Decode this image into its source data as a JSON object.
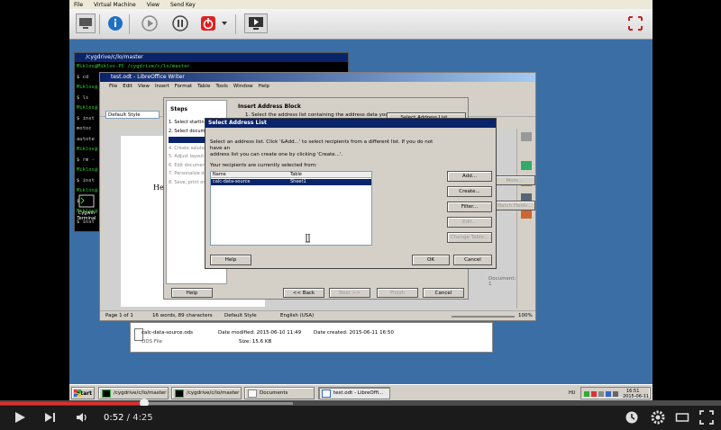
{
  "vm_menu": [
    "File",
    "Virtual Machine",
    "View",
    "Send Key"
  ],
  "cygwin": {
    "title": "/cygdrive/c/lo/master",
    "lines": [
      {
        "text": "Miklos@Miklos-PC /cygdrive/c/lo/master",
        "green": true
      },
      {
        "text": "$ cd",
        "green": false
      },
      {
        "text": "Miklos@",
        "green": true
      },
      {
        "text": "$ ls",
        "green": false
      },
      {
        "text": "Miklos@",
        "green": true
      },
      {
        "text": "$ inst",
        "green": false
      },
      {
        "text": "motoc",
        "green": false
      },
      {
        "text": "autote",
        "green": false
      },
      {
        "text": "Miklos@",
        "green": true
      },
      {
        "text": "$ rm -",
        "green": false
      },
      {
        "text": "Miklos@",
        "green": true
      },
      {
        "text": "$ inst",
        "green": false
      },
      {
        "text": "Miklos@",
        "green": true
      },
      {
        "text": "$ rm -",
        "green": false
      },
      {
        "text": "Miklos@",
        "green": true
      },
      {
        "text": "$ inst",
        "green": false
      }
    ]
  },
  "desktop_icon": {
    "line1": "Cygwin",
    "line2": "Terminal"
  },
  "writer": {
    "title": "test.odt - LibreOffice Writer",
    "menu": [
      "File",
      "Edit",
      "View",
      "Insert",
      "Format",
      "Table",
      "Tools",
      "Window",
      "Help"
    ],
    "style": "Default Style",
    "page_text": "Hel",
    "status": {
      "page": "Page 1 of 1",
      "words": "16 words, 89 characters",
      "style": "Default Style",
      "lang": "English (USA)",
      "zoom": "100%"
    }
  },
  "wizard": {
    "steps_title": "Steps",
    "steps": [
      {
        "label": "1. Select starting",
        "state": "normal"
      },
      {
        "label": "2. Select document",
        "state": "normal"
      },
      {
        "label": "3. Insert address",
        "state": "selected"
      },
      {
        "label": "4. Create salutati",
        "state": "dim"
      },
      {
        "label": "5. Adjust layout",
        "state": "dim"
      },
      {
        "label": "6. Edit document",
        "state": "dim"
      },
      {
        "label": "7. Personalize do",
        "state": "dim"
      },
      {
        "label": "8. Save, print or",
        "state": "dim"
      }
    ],
    "heading": "Insert Address Block",
    "step1": "1.      Select the address list containing the address data you",
    "select_list_btn": "Select Address List...",
    "more_btn": "More...",
    "match_btn": "Match Fields...",
    "document_label": "Document: 1",
    "help": "Help",
    "back": "<< Back",
    "next": "Next >>",
    "finish": "Finish",
    "cancel": "Cancel"
  },
  "select_address_list": {
    "title": "Select Address List",
    "desc1": "Select an address list. Click '&Add...' to select recipients from a different list. If you do not have an",
    "desc2": "address list you can create one by clicking 'Create...'.",
    "current": "Your recipients are currently selected from:",
    "col_name": "Name",
    "col_table": "Table",
    "row_name": "calc-data-source",
    "row_table": "Sheet1",
    "add": "Add...",
    "create": "Create...",
    "filter": "Filter...",
    "edit": "Edit...",
    "change_table": "Change Table...",
    "help": "Help",
    "ok": "OK",
    "cancel": "Cancel"
  },
  "explorer": {
    "file": "calc-data-source.ods",
    "type": "ODS File",
    "modified": "Date modified: 2015-06-10 11:49",
    "size": "Size: 15.6 KB",
    "created": "Date created: 2015-06-11 16:50"
  },
  "taskbar": {
    "start": "Start",
    "tasks": [
      "/cygdrive/c/lo/master",
      "/cygdrive/c/lo/master",
      "Documents",
      "test.odt - LibreOffi..."
    ],
    "lang": "HU",
    "time": "16:51",
    "date": "2015-06-11"
  },
  "player": {
    "current": "0:52",
    "total": "/ 4:25",
    "played_fraction": 0.2
  }
}
